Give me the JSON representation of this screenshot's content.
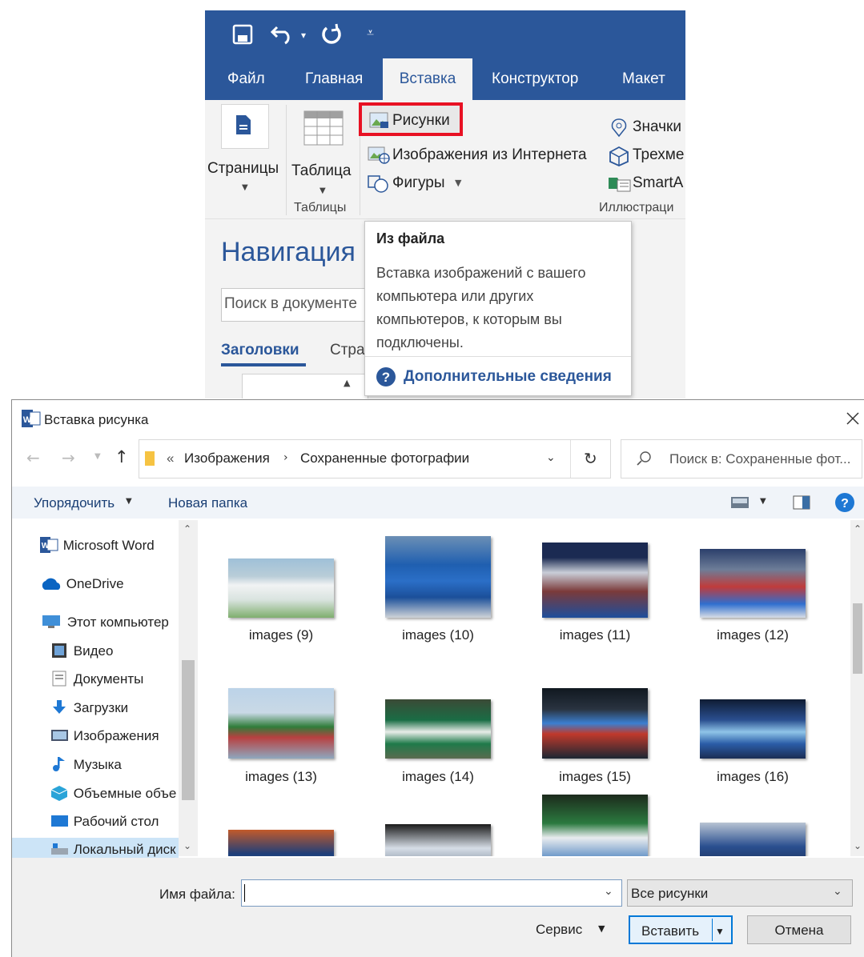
{
  "word": {
    "tabs": [
      "Файл",
      "Главная",
      "Вставка",
      "Конструктор",
      "Макет"
    ],
    "ribbon": {
      "pages": "Страницы",
      "table": "Таблица",
      "pictures": "Рисунки",
      "online_pictures": "Изображения из Интернета",
      "shapes": "Фигуры",
      "icons": "Значки",
      "models3d": "Трехме",
      "smartart": "SmartA",
      "group_tables": "Таблицы",
      "group_illustrations": "Иллюстраци"
    },
    "nav": {
      "title": "Навигация",
      "search_placeholder": "Поиск в документе",
      "tab_headings": "Заголовки",
      "tab_pages": "Стра"
    },
    "tooltip": {
      "title": "Из файла",
      "body": "Вставка изображений с вашего компьютера или других компьютеров, к которым вы подключены.",
      "more": "Дополнительные сведения"
    },
    "accent": "#2b579a",
    "highlight": "#e81123"
  },
  "dialog": {
    "title": "Вставка рисунка",
    "path_prefix": "«",
    "path": [
      "Изображения",
      "Сохраненные фотографии"
    ],
    "search_placeholder": "Поиск в: Сохраненные фот...",
    "organize": "Упорядочить",
    "new_folder": "Новая папка",
    "nav_items": [
      {
        "label": "Microsoft Word",
        "icon": "word-icon"
      },
      {
        "label": "OneDrive",
        "icon": "cloud-icon"
      },
      {
        "label": "Этот компьютер",
        "icon": "computer-icon"
      },
      {
        "label": "Видео",
        "icon": "video-icon"
      },
      {
        "label": "Документы",
        "icon": "documents-icon"
      },
      {
        "label": "Загрузки",
        "icon": "download-icon"
      },
      {
        "label": "Изображения",
        "icon": "pictures-icon"
      },
      {
        "label": "Музыка",
        "icon": "music-icon"
      },
      {
        "label": "Объемные объе",
        "icon": "objects3d-icon"
      },
      {
        "label": "Рабочий стол",
        "icon": "desktop-icon"
      },
      {
        "label": "Локальный диск",
        "icon": "disk-icon"
      }
    ],
    "files": [
      "images (9)",
      "images (10)",
      "images (11)",
      "images (12)",
      "images (13)",
      "images (14)",
      "images (15)",
      "images (16)"
    ],
    "filename_label": "Имя файла:",
    "filename_value": "",
    "filetype": "Все рисунки",
    "service": "Сервис",
    "insert": "Вставить",
    "cancel": "Отмена"
  }
}
